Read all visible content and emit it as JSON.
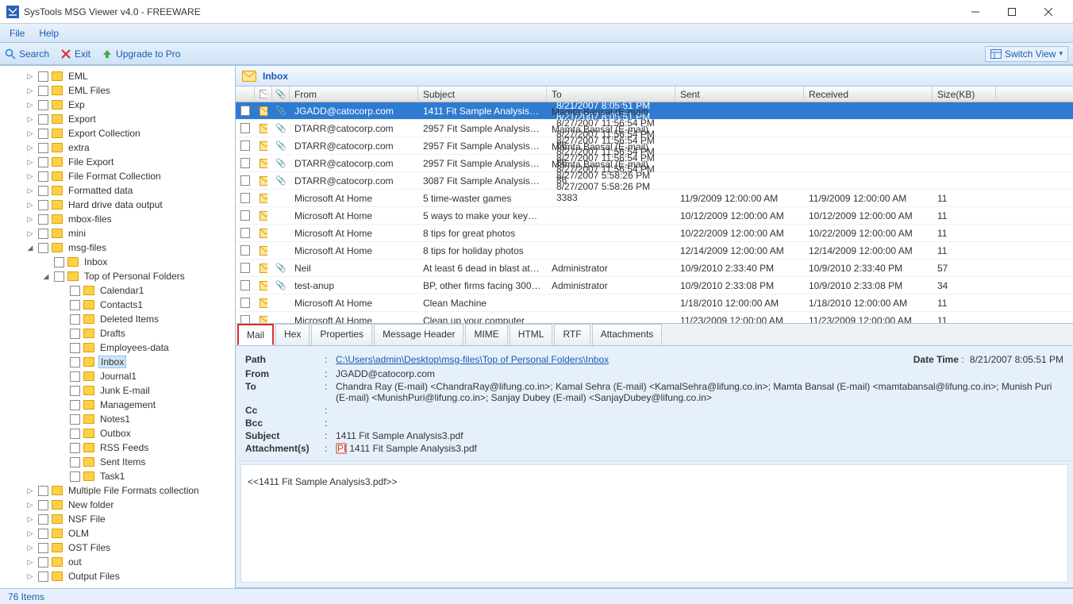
{
  "title": "SysTools MSG Viewer  v4.0 - FREEWARE",
  "menubar": {
    "file": "File",
    "help": "Help"
  },
  "toolbar": {
    "search": "Search",
    "exit": "Exit",
    "upgrade": "Upgrade to Pro",
    "switch": "Switch View"
  },
  "tree": [
    {
      "ind": 1,
      "exp": ">",
      "label": "EML"
    },
    {
      "ind": 1,
      "exp": ">",
      "label": "EML Files"
    },
    {
      "ind": 1,
      "exp": ">",
      "label": "Exp"
    },
    {
      "ind": 1,
      "exp": ">",
      "label": "Export"
    },
    {
      "ind": 1,
      "exp": ">",
      "label": "Export Collection"
    },
    {
      "ind": 1,
      "exp": ">",
      "label": "extra"
    },
    {
      "ind": 1,
      "exp": ">",
      "label": "File Export"
    },
    {
      "ind": 1,
      "exp": ">",
      "label": "File Format Collection"
    },
    {
      "ind": 1,
      "exp": ">",
      "label": "Formatted data"
    },
    {
      "ind": 1,
      "exp": ">",
      "label": "Hard drive data output"
    },
    {
      "ind": 1,
      "exp": ">",
      "label": "mbox-files"
    },
    {
      "ind": 1,
      "exp": ">",
      "label": "mini"
    },
    {
      "ind": 1,
      "exp": "v",
      "label": "msg-files"
    },
    {
      "ind": 2,
      "exp": "",
      "label": "Inbox"
    },
    {
      "ind": 2,
      "exp": "v",
      "label": "Top of Personal Folders"
    },
    {
      "ind": 3,
      "exp": "",
      "label": "Calendar1"
    },
    {
      "ind": 3,
      "exp": "",
      "label": "Contacts1"
    },
    {
      "ind": 3,
      "exp": "",
      "label": "Deleted Items"
    },
    {
      "ind": 3,
      "exp": "",
      "label": "Drafts"
    },
    {
      "ind": 3,
      "exp": "",
      "label": "Employees-data"
    },
    {
      "ind": 3,
      "exp": "",
      "label": "Inbox",
      "selected": true
    },
    {
      "ind": 3,
      "exp": "",
      "label": "Journal1"
    },
    {
      "ind": 3,
      "exp": "",
      "label": "Junk E-mail"
    },
    {
      "ind": 3,
      "exp": "",
      "label": "Management"
    },
    {
      "ind": 3,
      "exp": "",
      "label": "Notes1"
    },
    {
      "ind": 3,
      "exp": "",
      "label": "Outbox"
    },
    {
      "ind": 3,
      "exp": "",
      "label": "RSS Feeds"
    },
    {
      "ind": 3,
      "exp": "",
      "label": "Sent Items"
    },
    {
      "ind": 3,
      "exp": "",
      "label": "Task1"
    },
    {
      "ind": 1,
      "exp": ">",
      "label": "Multiple File Formats collection"
    },
    {
      "ind": 1,
      "exp": ">",
      "label": "New folder"
    },
    {
      "ind": 1,
      "exp": ">",
      "label": "NSF File"
    },
    {
      "ind": 1,
      "exp": ">",
      "label": "OLM"
    },
    {
      "ind": 1,
      "exp": ">",
      "label": "OST Files"
    },
    {
      "ind": 1,
      "exp": ">",
      "label": "out"
    },
    {
      "ind": 1,
      "exp": ">",
      "label": "Output Files"
    }
  ],
  "inbox_header": "Inbox",
  "columns": {
    "from": "From",
    "subject": "Subject",
    "to": "To",
    "sent": "Sent",
    "received": "Received",
    "size": "Size(KB)"
  },
  "rows": [
    {
      "att": true,
      "from": "JGADD@catocorp.com",
      "subject": "1411 Fit Sample Analysis3.pdf",
      "to": "Chandra Ray (E-mail) <Chan...",
      "sent": "8/21/2007 8:05:51 PM",
      "recv": "8/21/2007 8:05:51 PM",
      "size": "94",
      "selected": true
    },
    {
      "att": true,
      "from": "DTARR@catocorp.com",
      "subject": "2957 Fit Sample Analysis5.pdf",
      "to": "Mamta Bansal (E-mail) <ma...",
      "sent": "8/27/2007 11:56:54 PM",
      "recv": "8/27/2007 11:56:54 PM",
      "size": "86"
    },
    {
      "att": true,
      "from": "DTARR@catocorp.com",
      "subject": "2957 Fit Sample Analysis5.pdf",
      "to": "Mamta Bansal (E-mail) <ma...",
      "sent": "8/27/2007 11:56:54 PM",
      "recv": "8/27/2007 11:56:54 PM",
      "size": "86"
    },
    {
      "att": true,
      "from": "DTARR@catocorp.com",
      "subject": "2957 Fit Sample Analysis5.pdf",
      "to": "Mamta Bansal (E-mail) <ma...",
      "sent": "8/27/2007 11:56:54 PM",
      "recv": "8/27/2007 11:56:54 PM",
      "size": "86"
    },
    {
      "att": true,
      "from": "DTARR@catocorp.com",
      "subject": "3087 Fit Sample Analysis3.pdf",
      "to": "Mamta Bansal (E-mail) <ma...",
      "sent": "8/27/2007 5:58:26 PM",
      "recv": "8/27/2007 5:58:26 PM",
      "size": "3383"
    },
    {
      "att": false,
      "from": "Microsoft At Home",
      "subject": "5 time-waster games",
      "to": "",
      "sent": "11/9/2009 12:00:00 AM",
      "recv": "11/9/2009 12:00:00 AM",
      "size": "11"
    },
    {
      "att": false,
      "from": "Microsoft At Home",
      "subject": "5 ways to make your keyboa...",
      "to": "",
      "sent": "10/12/2009 12:00:00 AM",
      "recv": "10/12/2009 12:00:00 AM",
      "size": "11"
    },
    {
      "att": false,
      "from": "Microsoft At Home",
      "subject": "8 tips for great  photos",
      "to": "",
      "sent": "10/22/2009 12:00:00 AM",
      "recv": "10/22/2009 12:00:00 AM",
      "size": "11"
    },
    {
      "att": false,
      "from": "Microsoft At Home",
      "subject": "8 tips for holiday photos",
      "to": "",
      "sent": "12/14/2009 12:00:00 AM",
      "recv": "12/14/2009 12:00:00 AM",
      "size": "11"
    },
    {
      "att": true,
      "from": "Neil",
      "subject": "At least 6 dead in blast at C...",
      "to": "Administrator",
      "sent": "10/9/2010 2:33:40 PM",
      "recv": "10/9/2010 2:33:40 PM",
      "size": "57"
    },
    {
      "att": true,
      "from": "test-anup",
      "subject": "BP, other firms facing 300 la...",
      "to": "Administrator",
      "sent": "10/9/2010 2:33:08 PM",
      "recv": "10/9/2010 2:33:08 PM",
      "size": "34"
    },
    {
      "att": false,
      "from": "Microsoft At Home",
      "subject": "Clean Machine",
      "to": "",
      "sent": "1/18/2010 12:00:00 AM",
      "recv": "1/18/2010 12:00:00 AM",
      "size": "11"
    },
    {
      "att": false,
      "from": "Microsoft At Home",
      "subject": "Clean up your computer",
      "to": "",
      "sent": "11/23/2009 12:00:00 AM",
      "recv": "11/23/2009 12:00:00 AM",
      "size": "11"
    }
  ],
  "tabs": [
    "Mail",
    "Hex",
    "Properties",
    "Message Header",
    "MIME",
    "HTML",
    "RTF",
    "Attachments"
  ],
  "detail": {
    "path_k": "Path",
    "path_v": "C:\\Users\\admin\\Desktop\\msg-files\\Top of Personal Folders\\Inbox",
    "dt_k": "Date Time",
    "dt_v": "8/21/2007 8:05:51 PM",
    "from_k": "From",
    "from_v": "JGADD@catocorp.com",
    "to_k": "To",
    "to_v": "Chandra Ray (E-mail) <ChandraRay@lifung.co.in>; Kamal Sehra (E-mail) <KamalSehra@lifung.co.in>; Mamta Bansal (E-mail) <mamtabansal@lifung.co.in>; Munish Puri (E-mail) <MunishPuri@lifung.co.in>; Sanjay Dubey (E-mail) <SanjayDubey@lifung.co.in>",
    "cc_k": "Cc",
    "cc_v": "",
    "bcc_k": "Bcc",
    "bcc_v": "",
    "subj_k": "Subject",
    "subj_v": "1411 Fit Sample Analysis3.pdf",
    "att_k": "Attachment(s)",
    "att_v": "1411 Fit Sample Analysis3.pdf",
    "body": "<<1411 Fit Sample Analysis3.pdf>>"
  },
  "status": "76 Items"
}
